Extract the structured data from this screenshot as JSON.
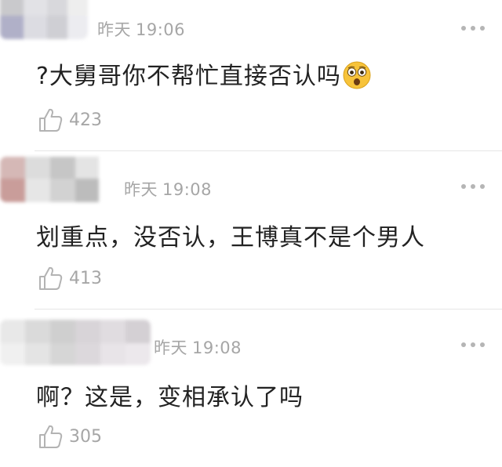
{
  "comments": [
    {
      "date": "昨天",
      "time": "19:06",
      "text": "?大舅哥你不帮忙直接否认吗",
      "emoji": "flushed-face-emoji",
      "likes": "423"
    },
    {
      "date": "昨天",
      "time": "19:08",
      "text": "划重点，没否认，王博真不是个男人",
      "likes": "413"
    },
    {
      "date": "昨天",
      "time": "19:08",
      "text": "啊？这是，变相承认了吗",
      "likes": "305"
    }
  ],
  "icons": {
    "like": "thumbs-up-icon",
    "more": "more-dots-icon"
  },
  "colors": {
    "meta_text": "#a6a6a6",
    "body_text": "#222222",
    "divider": "#e6e6e6"
  }
}
